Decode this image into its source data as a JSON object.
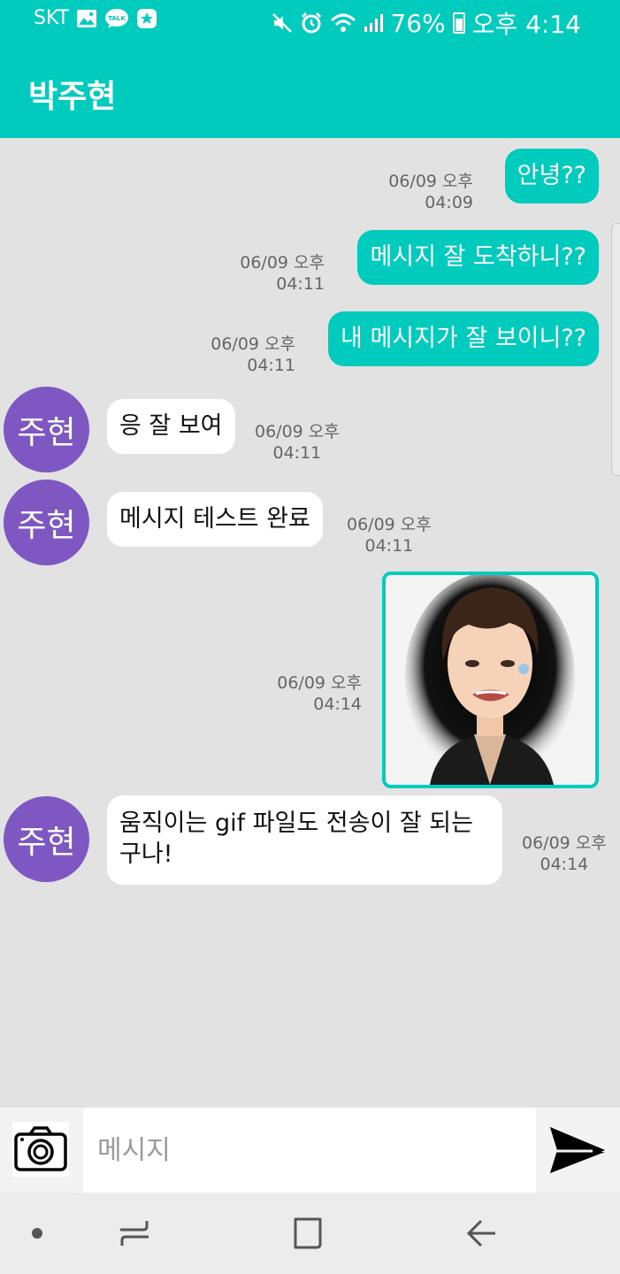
{
  "status_bar": {
    "carrier": "SKT",
    "battery": "76%",
    "time": "오후 4:14",
    "icons": [
      "image-icon",
      "talk-icon",
      "star-badge-icon",
      "mute-icon",
      "alarm-icon",
      "wifi-icon",
      "signal-icon",
      "battery-icon"
    ]
  },
  "header": {
    "title": "박주현"
  },
  "messages": [
    {
      "direction": "outgoing",
      "text": "안녕??",
      "date": "06/09 오후",
      "time": "04:09"
    },
    {
      "direction": "outgoing",
      "text": "메시지 잘 도착하니??",
      "date": "06/09 오후",
      "time": "04:11"
    },
    {
      "direction": "outgoing",
      "text": "내 메시지가 잘 보이니??",
      "date": "06/09 오후",
      "time": "04:11"
    },
    {
      "direction": "incoming",
      "sender": "주현",
      "text": "응 잘 보여",
      "date": "06/09 오후",
      "time": "04:11"
    },
    {
      "direction": "incoming",
      "sender": "주현",
      "text": "메시지 테스트 완료",
      "date": "06/09 오후",
      "time": "04:11"
    },
    {
      "direction": "outgoing",
      "type": "image",
      "date": "06/09 오후",
      "time": "04:14"
    },
    {
      "direction": "incoming",
      "sender": "주현",
      "text": "움직이는 gif 파일도 전송이 잘 되는구나!",
      "date": "06/09 오후",
      "time": "04:14"
    }
  ],
  "input": {
    "placeholder": "메시지"
  },
  "colors": {
    "accent": "#00cbbd",
    "avatar": "#7e57c2",
    "chat_bg": "#e2e2e2"
  }
}
